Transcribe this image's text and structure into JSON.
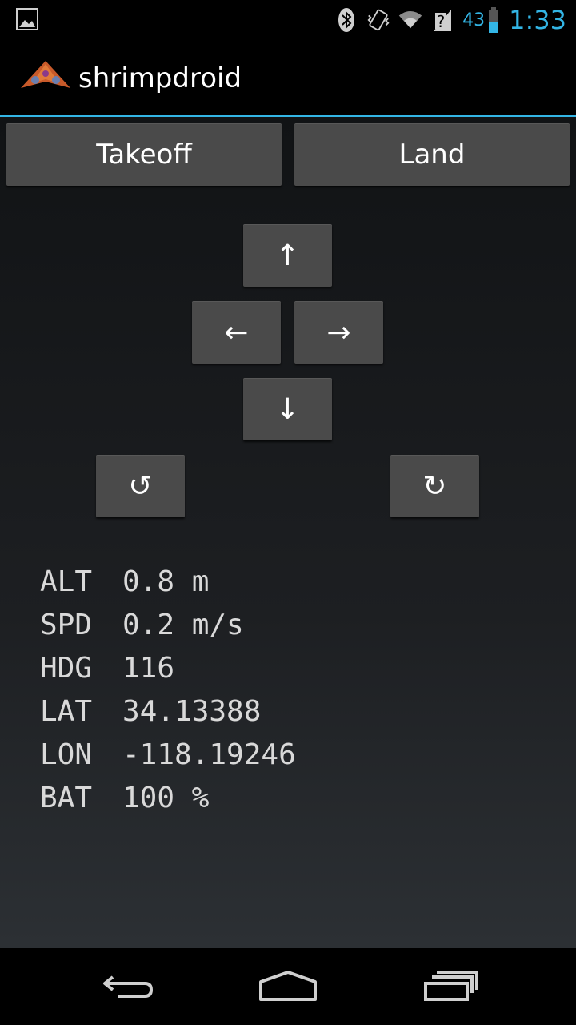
{
  "status_bar": {
    "gallery_icon": "image-icon",
    "icons": [
      "bluetooth-icon",
      "vibrate-icon",
      "wifi-icon",
      "signal-unknown-icon"
    ],
    "battery_level": "43",
    "time": "1:33"
  },
  "app": {
    "title": "shrimpdroid",
    "logo": "drone-logo"
  },
  "controls": {
    "takeoff_label": "Takeoff",
    "land_label": "Land",
    "up_label": "↑",
    "left_label": "←",
    "right_label": "→",
    "down_label": "↓",
    "rotate_ccw_label": "↺",
    "rotate_cw_label": "↻"
  },
  "telemetry": [
    {
      "label": "ALT",
      "value": "0.8 m"
    },
    {
      "label": "SPD",
      "value": "0.2 m/s"
    },
    {
      "label": "HDG",
      "value": "116"
    },
    {
      "label": "LAT",
      "value": "34.13388"
    },
    {
      "label": "LON",
      "value": "-118.19246"
    },
    {
      "label": "BAT",
      "value": "100 %"
    }
  ],
  "nav_bar": {
    "back": "back-icon",
    "home": "home-icon",
    "recents": "recents-icon"
  },
  "colors": {
    "accent": "#33b5e5",
    "button": "#4a4a4a",
    "text": "#d9d9d9"
  }
}
